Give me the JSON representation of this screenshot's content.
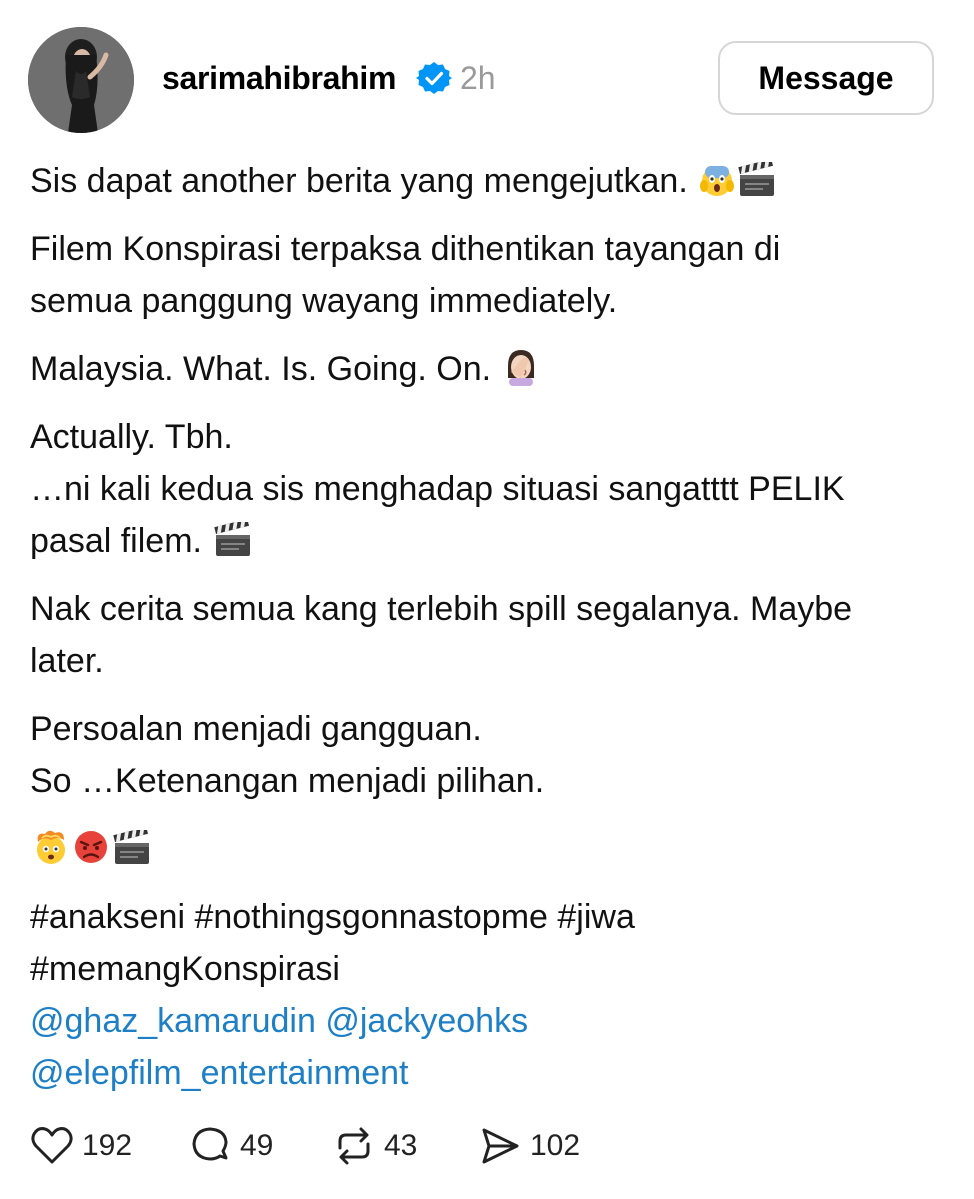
{
  "post": {
    "author": {
      "username": "sarimahibrahim",
      "verified_icon": "verified-badge-icon",
      "avatar_icon": "profile-photo"
    },
    "timestamp": "2h",
    "message_button_label": "Message",
    "paragraphs": [
      {
        "lines": [
          "Sis dapat another berita yang mengejutkan."
        ],
        "emoji": [
          "face-screaming-in-fear",
          "clapper-board"
        ]
      },
      {
        "lines": [
          "Filem Konspirasi terpaksa dithentikan tayangan di",
          "semua panggung wayang immediately."
        ]
      },
      {
        "lines": [
          "Malaysia. What. Is. Going. On."
        ],
        "emoji": [
          "woman-facepalming"
        ]
      },
      {
        "lines": [
          "Actually. Tbh.",
          "…ni kali kedua sis menghadap situasi sangatttt PELIK",
          "pasal filem."
        ],
        "emoji": [
          "clapper-board"
        ]
      },
      {
        "lines": [
          "Nak cerita semua kang terlebih spill segalanya. Maybe",
          "later."
        ]
      },
      {
        "lines": [
          "Persoalan menjadi gangguan.",
          "So …Ketenangan menjadi pilihan."
        ]
      }
    ],
    "emoji_line": [
      "exploding-head",
      "pouting-face",
      "clapper-board"
    ],
    "hashtags": [
      "#anakseni #nothingsgonnastopme #jiwa",
      "#memangKonspirasi"
    ],
    "mentions": [
      "@ghaz_kamarudin",
      "@jackyeohks",
      "@elepfilm_entertainment"
    ],
    "actions": {
      "likes": {
        "icon": "heart-icon",
        "count": "192"
      },
      "replies": {
        "icon": "comment-icon",
        "count": "49"
      },
      "reposts": {
        "icon": "repost-icon",
        "count": "43"
      },
      "shares": {
        "icon": "send-icon",
        "count": "102"
      }
    },
    "colors": {
      "mention": "#1d7fc6",
      "verified": "#0095f6",
      "timestamp": "#9a9a9a",
      "border": "#d6d6d6"
    }
  }
}
